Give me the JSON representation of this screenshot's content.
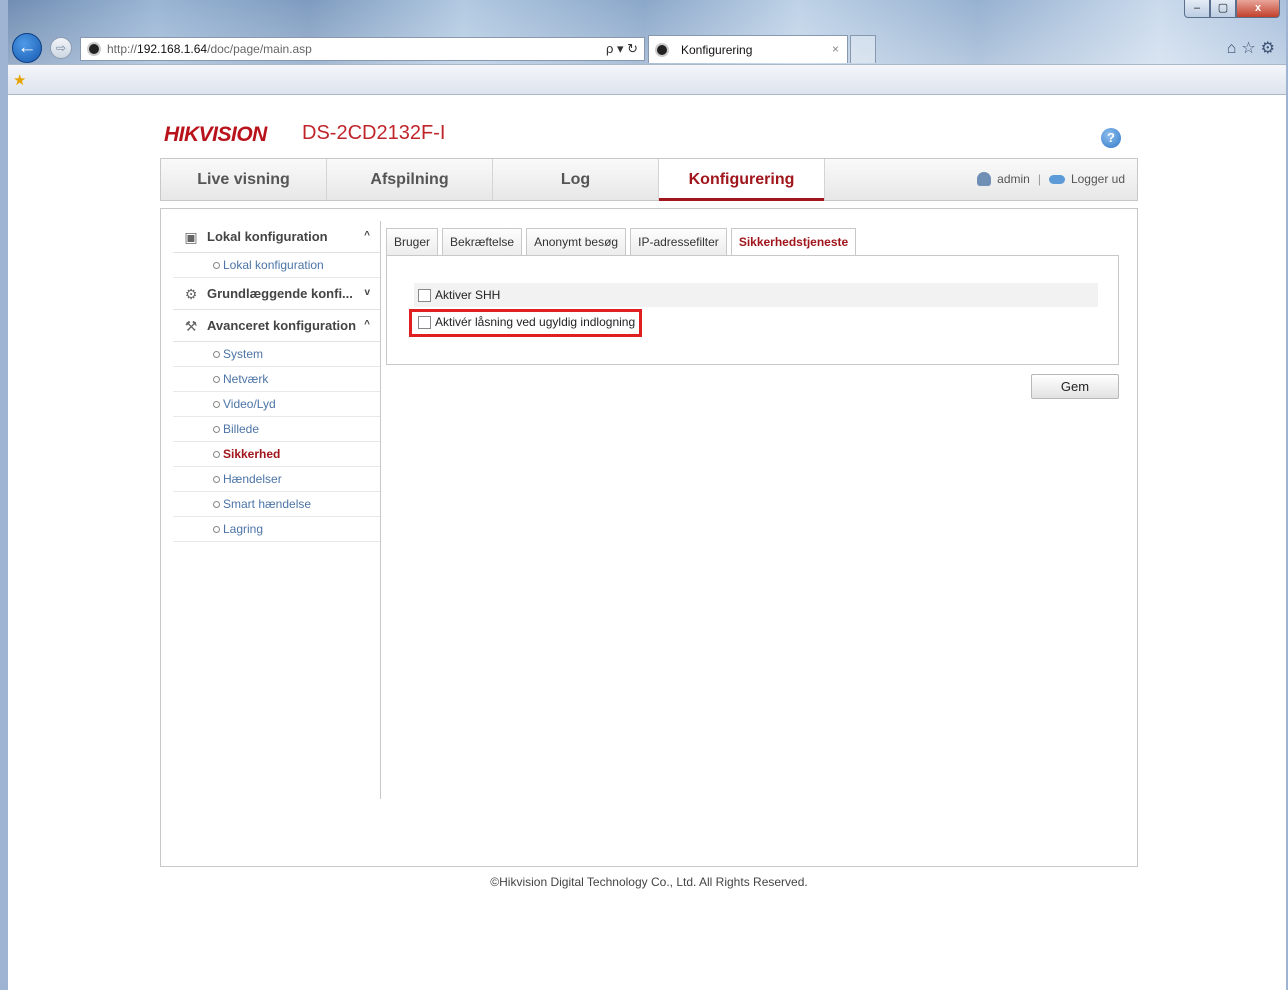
{
  "browser": {
    "url_prefix": "http://",
    "url_host": "192.168.1.64",
    "url_path": "/doc/page/main.asp",
    "addr_tools": "ρ ▾ ↻",
    "tab_title": "Konfigurering",
    "tab_close": "×",
    "win_min": "–",
    "win_max": "▢",
    "win_close": "x"
  },
  "header": {
    "brand": "HIKVISION",
    "model": "DS-2CD2132F-I",
    "help": "?"
  },
  "mainnav": {
    "items": [
      {
        "label": "Live visning"
      },
      {
        "label": "Afspilning"
      },
      {
        "label": "Log"
      },
      {
        "label": "Konfigurering"
      }
    ],
    "user": "admin",
    "separator": "|",
    "logout": "Logger ud"
  },
  "sidebar": {
    "local": {
      "title": "Lokal konfiguration",
      "items": [
        "Lokal konfiguration"
      ]
    },
    "basic": {
      "title": "Grundlæggende konfi..."
    },
    "advanced": {
      "title": "Avanceret konfiguration",
      "items": [
        "System",
        "Netværk",
        "Video/Lyd",
        "Billede",
        "Sikkerhed",
        "Hændelser",
        "Smart hændelse",
        "Lagring"
      ]
    },
    "chevron_up": "^",
    "chevron_down": "v"
  },
  "subtabs": [
    "Bruger",
    "Bekræftelse",
    "Anonymt besøg",
    "IP-adressefilter",
    "Sikkerhedstjeneste"
  ],
  "settings": {
    "ssh": "Aktiver SHH",
    "lock": "Aktivér låsning ved ugyldig indlogning"
  },
  "save_label": "Gem",
  "footer": "©Hikvision Digital Technology Co., Ltd. All Rights Reserved.",
  "colors": {
    "accent": "#a0161c",
    "link": "#4c74a6",
    "highlight": "#e02020"
  }
}
